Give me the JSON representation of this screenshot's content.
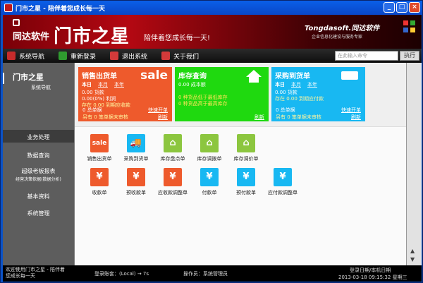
{
  "window": {
    "title": "门市之星 - 陪伴着您成长每一天",
    "btn_min": "_",
    "btn_max": "□",
    "btn_close": "×"
  },
  "banner": {
    "logo_text": "同达软件",
    "big": "门市之星",
    "slogan": "陪伴着您成长每一天!",
    "brand": "Tongdasoft.同达软件",
    "brand_sub": "企业信息化建设与服务专家"
  },
  "nav": {
    "items": [
      {
        "label": "系统导航",
        "color": "#c62b2b"
      },
      {
        "label": "重新登录",
        "color": "#2f9b2f"
      },
      {
        "label": "退出系统",
        "color": "#d43a3a"
      },
      {
        "label": "关于我们",
        "color": "#d43a3a"
      }
    ],
    "search_placeholder": "在此输入命令",
    "run": "执行"
  },
  "side": {
    "logo_l1": "门市之星",
    "logo_l2": "系统导航",
    "items": [
      {
        "label": "业务处理",
        "active": true
      },
      {
        "label": "数据查询"
      },
      {
        "label": "超级老板报表",
        "sub": "经营决策依据(数据分析)"
      },
      {
        "label": "基本资料"
      },
      {
        "label": "系统管理"
      }
    ]
  },
  "cards": [
    {
      "title": "销售出货单",
      "big": "sale",
      "bg": "#ee5a2c",
      "tabs": [
        "本日",
        "本月",
        "本年"
      ],
      "lines": [
        "0.00 货款",
        "0.00(0%) 利润",
        "存在 0.00 到期应收款"
      ],
      "bottom1": "0 总单据",
      "bottom2": "另有 0 笔单据未审核",
      "link": "快速开单",
      "refresh": "刷新"
    },
    {
      "title": "库存查询",
      "bg": "#1fd90f",
      "tabs": [],
      "lines": [
        "0.00 成本额",
        "",
        "0 种货品低于最低库存",
        "0 种货品高于最高库存"
      ],
      "bottom1": "",
      "bottom2": "",
      "link": "",
      "refresh": "刷新"
    },
    {
      "title": "采购到货单",
      "bg": "#18b8f2",
      "tabs": [
        "本日",
        "本月",
        "本年"
      ],
      "lines": [
        "0.00 货款",
        "存在 0.00 到期应付款"
      ],
      "bottom1": "0 总单据",
      "bottom2": "另有 0 笔单据未审核",
      "link": "快速开单",
      "refresh": "刷新"
    }
  ],
  "quick": [
    {
      "label": "销售出货单",
      "color": "#ee5a2c",
      "glyph": "sale"
    },
    {
      "label": "采购到货单",
      "color": "#18b8f2",
      "glyph": "🚚"
    },
    {
      "label": "库存盘点单",
      "color": "#8cc63f",
      "glyph": "⌂"
    },
    {
      "label": "库存调拨单",
      "color": "#8cc63f",
      "glyph": "⌂"
    },
    {
      "label": "库存调价单",
      "color": "#8cc63f",
      "glyph": "⌂"
    },
    {
      "label": "收款单",
      "color": "#ee5a2c",
      "glyph": "¥"
    },
    {
      "label": "预收款单",
      "color": "#ee5a2c",
      "glyph": "¥"
    },
    {
      "label": "应收款调整单",
      "color": "#ee5a2c",
      "glyph": "¥"
    },
    {
      "label": "付款单",
      "color": "#18b8f2",
      "glyph": "¥"
    },
    {
      "label": "预付款单",
      "color": "#18b8f2",
      "glyph": "¥"
    },
    {
      "label": "应付款调整单",
      "color": "#18b8f2",
      "glyph": "¥"
    }
  ],
  "status": {
    "welcome": "欢迎使用门市之星 - 陪伴着您成长每一天",
    "account": "登录账套：(Local) → 7s",
    "operator": "操作员：系统管理员",
    "date_label": "登录日期/本机日期",
    "date": "2013-03-18 09:15:32 星期三"
  }
}
